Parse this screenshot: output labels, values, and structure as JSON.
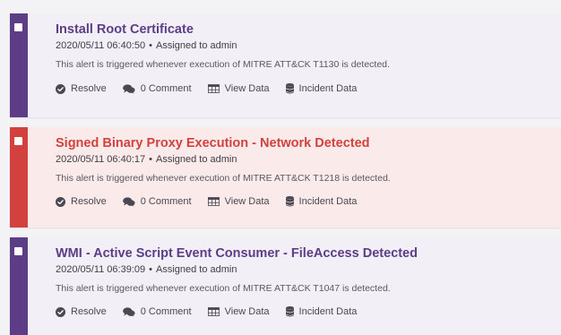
{
  "colors": {
    "purple": "#5c3d86",
    "red": "#d2413d",
    "card_purple_bg": "#f2eff7",
    "card_red_bg": "#fbeaea",
    "icon": "#4a4850"
  },
  "alerts": [
    {
      "severity_color": "#5c3d86",
      "title": "Install Root Certificate",
      "timestamp": "2020/05/11 06:40:50",
      "separator": "•",
      "assigned": "Assigned to admin",
      "description": "This alert is triggered whenever execution of MITRE ATT&CK T1130 is detected.",
      "actions": {
        "resolve": "Resolve",
        "comment": "0 Comment",
        "view_data": "View Data",
        "incident_data": "Incident Data"
      }
    },
    {
      "severity_color": "#d2413d",
      "title": "Signed Binary Proxy Execution - Network Detected",
      "timestamp": "2020/05/11 06:40:17",
      "separator": "•",
      "assigned": "Assigned to admin",
      "description": "This alert is triggered whenever execution of MITRE ATT&CK T1218 is detected.",
      "actions": {
        "resolve": "Resolve",
        "comment": "0 Comment",
        "view_data": "View Data",
        "incident_data": "Incident Data"
      }
    },
    {
      "severity_color": "#5c3d86",
      "title": "WMI - Active Script Event Consumer - FileAccess Detected",
      "timestamp": "2020/05/11 06:39:09",
      "separator": "•",
      "assigned": "Assigned to admin",
      "description": "This alert is triggered whenever execution of MITRE ATT&CK T1047 is detected.",
      "actions": {
        "resolve": "Resolve",
        "comment": "0 Comment",
        "view_data": "View Data",
        "incident_data": "Incident Data"
      }
    }
  ],
  "icons": {
    "resolve": "check-circle-icon",
    "comment": "comments-icon",
    "view_data": "table-icon",
    "incident_data": "database-icon"
  }
}
